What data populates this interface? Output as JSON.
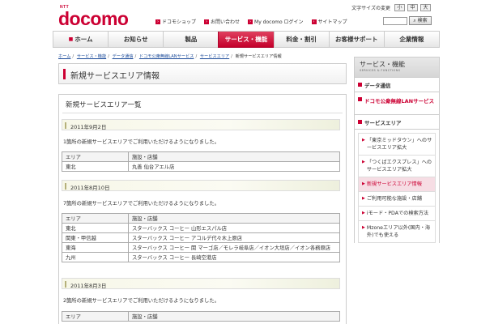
{
  "header": {
    "logo_small": "NTT",
    "logo_main": "docomo",
    "text_size_label": "文字サイズの変更",
    "size_buttons": [
      "小",
      "中",
      "大"
    ],
    "util_links": [
      "ドコモショップ",
      "お問い合わせ",
      "My docomo ログイン",
      "サイトマップ"
    ],
    "search_button": "検索"
  },
  "gnav": [
    "ホーム",
    "お知らせ",
    "製品",
    "サービス・機能",
    "料金・割引",
    "お客様サポート",
    "企業情報"
  ],
  "breadcrumb": [
    "ホーム",
    "サービス・機能",
    "データ通信",
    "ドコモ公衆無線LANサービス",
    "サービスエリア",
    "新規サービスエリア情報"
  ],
  "page_title": "新規サービスエリア情報",
  "panel_title": "新規サービスエリア一覧",
  "table_headers": [
    "エリア",
    "施設・店舗"
  ],
  "sections": [
    {
      "date": "2011年9月2日",
      "desc": "1箇所の新規サービスエリアでご利用いただけるようになりました。",
      "rows": [
        [
          "東北",
          "丸善 仙台アエル店"
        ]
      ]
    },
    {
      "date": "2011年8月10日",
      "desc": "7箇所の新規サービスエリアでご利用いただけるようになりました。",
      "rows": [
        [
          "東北",
          "スターバックス コーヒー 山形エスパル店"
        ],
        [
          "関東・甲信越",
          "スターバックス コーヒー アコルデ代々木上原店"
        ],
        [
          "東海",
          "スターバックス コーヒー 関 マーゴ店／モレラ岐阜店／イオン大垣店／イオン各務原店"
        ],
        [
          "九州",
          "スターバックス コーヒー 長崎空港店"
        ]
      ]
    },
    {
      "date": "2011年8月3日",
      "desc": "2箇所の新規サービスエリアでご利用いただけるようになりました。",
      "rows": []
    }
  ],
  "sidebar": {
    "title": "サービス・機能",
    "title_en": "SERVICES & FUNCTIONS",
    "cat1": "データ通信",
    "cat2": "ドコモ公衆無線LANサービス",
    "cat3": "サービスエリア",
    "items": [
      "「東京ミッドタウン」へのサービスエリア拡大",
      "「つくばエクスプレス」へのサービスエリア拡大",
      "新規サービスエリア情報",
      "ご利用可能な施設・店舗",
      "iモード・PDAでの検索方法",
      "Mzoneエリア以外(国内・海外)でも使える"
    ]
  },
  "colors": {
    "brand": "#cc0033",
    "active_sidebar_bg": "#f6dde4"
  }
}
